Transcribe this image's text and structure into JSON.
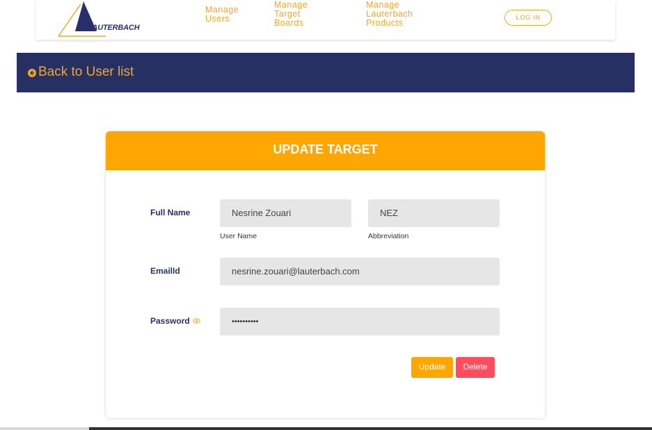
{
  "header": {
    "logo_text": "LAUTERBACH",
    "nav": [
      {
        "label_lines": [
          "Manage",
          "Users"
        ]
      },
      {
        "label_lines": [
          "Manage",
          "Target",
          "Boards"
        ]
      },
      {
        "label_lines": [
          "Manage",
          "Lauterbach",
          "Products"
        ]
      }
    ],
    "login_label": "LOG IN"
  },
  "banner": {
    "back_label": "Back to User list"
  },
  "form": {
    "title": "UPDATE TARGET",
    "full_name_label": "Full Name",
    "user_name_value": "Nesrine Zouari",
    "user_name_hint": "User Name",
    "abbreviation_value": "NEZ",
    "abbreviation_hint": "Abbreviation",
    "email_label": "EmailId",
    "email_value": "nesrine.zouari@lauterbach.com",
    "password_label": "Password",
    "password_value": "••••••••••",
    "update_label": "Update",
    "delete_label": "Delete"
  },
  "colors": {
    "accent": "#ffa600",
    "navy": "#263063",
    "delete": "#ff4d5e"
  },
  "icons": {
    "back": "arrow-left-circle-icon",
    "password": "eye-icon"
  }
}
